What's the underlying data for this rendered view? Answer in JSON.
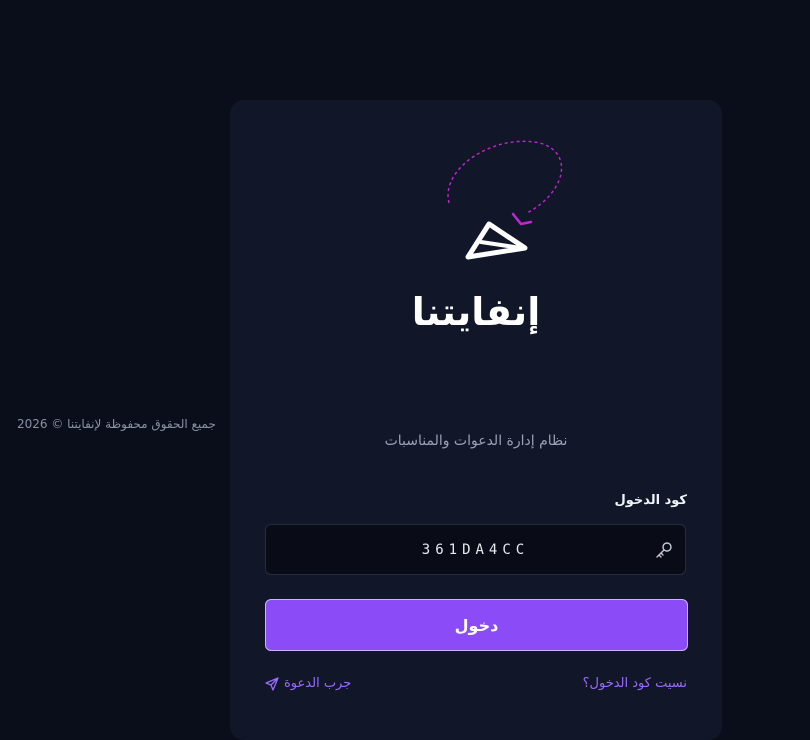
{
  "footer": {
    "copyright": "جميع الحقوق محفوظة لإنفايتنا © 2026"
  },
  "brand": {
    "name": "إنفايتنا",
    "tagline": "نظام إدارة الدعوات والمناسبات"
  },
  "form": {
    "code_label": "كود الدخول",
    "code_value": "361DA4CC",
    "submit_label": "دخول"
  },
  "links": {
    "forgot_code": "نسيت كود الدخول؟",
    "try_invitation": "جرب الدعوة"
  },
  "colors": {
    "background": "#0a0e1a",
    "card": "#111728",
    "accent": "#8b4cf7",
    "link": "#9b6bff",
    "logo_trail": "#c026d3"
  },
  "icons": {
    "logo": "paper-plane-logo-icon",
    "input": "key-icon",
    "try_link": "send-icon"
  }
}
